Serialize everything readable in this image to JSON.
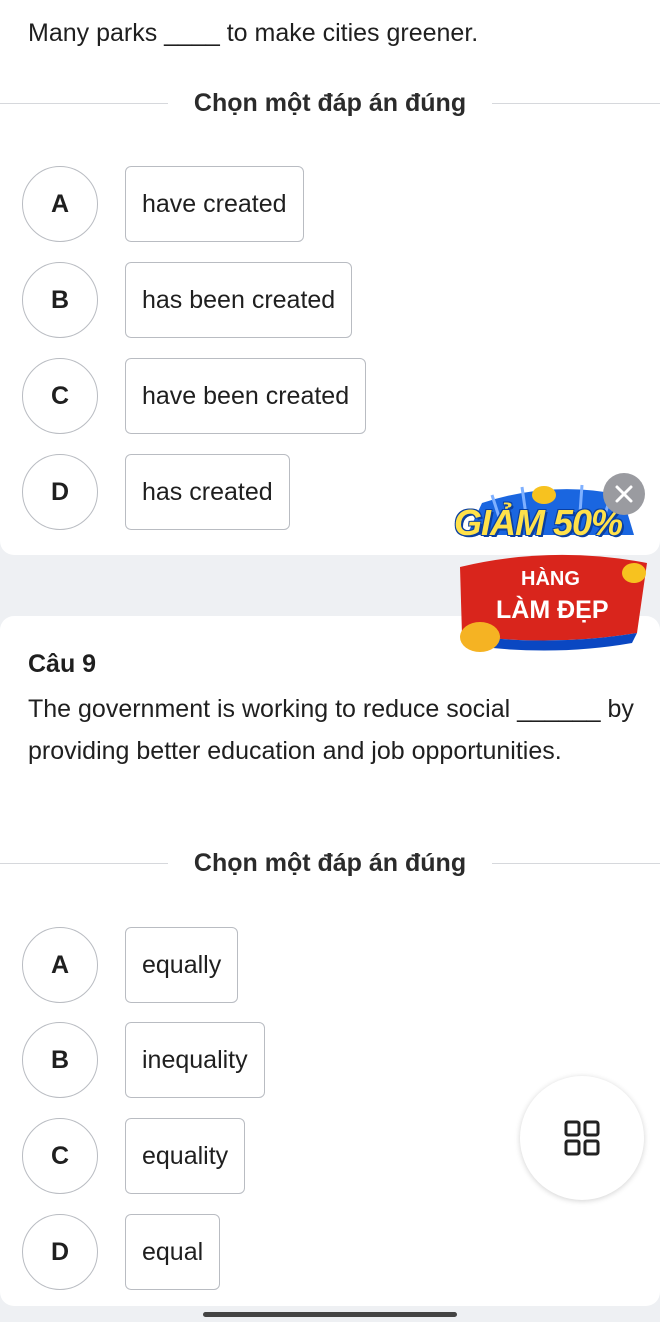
{
  "question1": {
    "text": "Many parks ____ to make cities greener.",
    "instruction": "Chọn một đáp án đúng",
    "options": [
      {
        "letter": "A",
        "text": "have created"
      },
      {
        "letter": "B",
        "text": "has been created"
      },
      {
        "letter": "C",
        "text": "have been created"
      },
      {
        "letter": "D",
        "text": "has created"
      }
    ]
  },
  "question2": {
    "number": "Câu 9",
    "text": "The government is working to reduce social ______ by providing better education and job opportunities.",
    "instruction": "Chọn một đáp án đúng",
    "options": [
      {
        "letter": "A",
        "text": "equally"
      },
      {
        "letter": "B",
        "text": "inequality"
      },
      {
        "letter": "C",
        "text": "equality"
      },
      {
        "letter": "D",
        "text": "equal"
      }
    ]
  },
  "promo": {
    "title": "GIẢM 50%",
    "line1": "HÀNG",
    "line2": "LÀM ĐẸP",
    "close_icon": "close-icon"
  },
  "fab": {
    "icon": "grid-icon"
  },
  "colors": {
    "page_bg": "#eef0f3",
    "card_bg": "#ffffff",
    "border": "#b9bcc2",
    "promo_red": "#d9251c",
    "promo_blue": "#0a47c2",
    "promo_yellow": "#ffe14a"
  }
}
